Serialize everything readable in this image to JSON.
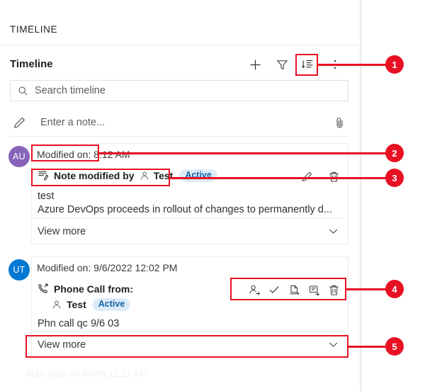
{
  "panel": {
    "title": "TIMELINE",
    "section_label": "Timeline"
  },
  "toolbar": {
    "add_label": "+",
    "icons": [
      {
        "name": "add-icon",
        "label": "Add"
      },
      {
        "name": "filter-icon",
        "label": "Filter"
      },
      {
        "name": "sort-icon",
        "label": "Sort"
      },
      {
        "name": "more-commands-icon",
        "label": "More commands"
      }
    ]
  },
  "search": {
    "placeholder": "Search timeline",
    "value": "",
    "icon": "search-icon"
  },
  "note_entry": {
    "placeholder": "Enter a note...",
    "value": "",
    "pencil_icon": "pencil-icon",
    "attach_icon": "paperclip-icon"
  },
  "timeline_items": [
    {
      "avatar_initials": "AU",
      "avatar_color": "#8764b8",
      "modified_on": "Modified on: 8:12 AM",
      "subject": "Note modified by",
      "subject_icon": "note-icon",
      "person_icon": "person-icon",
      "person": "Test",
      "status": "Active",
      "line1": "test",
      "line2": "Azure DevOps proceeds in rollout of changes to permanently d...",
      "view_more": "View more",
      "actions": [
        {
          "name": "edit-icon",
          "label": "Edit"
        },
        {
          "name": "delete-icon",
          "label": "Delete"
        }
      ]
    },
    {
      "avatar_initials": "UT",
      "avatar_color": "#0078d4",
      "modified_on": "Modified on: 9/6/2022 12:02 PM",
      "subject": "Phone Call from:",
      "subject_icon": "phone-call-icon",
      "person_icon": "person-icon",
      "person": "Test",
      "status": "Active",
      "line1": "Phn call qc 9/6 03",
      "view_more": "View more",
      "actions": [
        {
          "name": "assign-icon",
          "label": "Assign"
        },
        {
          "name": "check-icon",
          "label": "Mark complete"
        },
        {
          "name": "add-document-icon",
          "label": "Add to queue"
        },
        {
          "name": "convert-icon",
          "label": "Convert to"
        },
        {
          "name": "delete-icon",
          "label": "Delete"
        }
      ]
    }
  ],
  "partial_row": {
    "text": "Auto-post  on  Hillim  11:11 AM"
  },
  "callouts": [
    {
      "number": "1"
    },
    {
      "number": "2"
    },
    {
      "number": "3"
    },
    {
      "number": "4"
    },
    {
      "number": "5"
    }
  ],
  "colors": {
    "accent_red": "#e81123",
    "badge_bg": "#deecf9",
    "badge_text": "#1264a3"
  }
}
